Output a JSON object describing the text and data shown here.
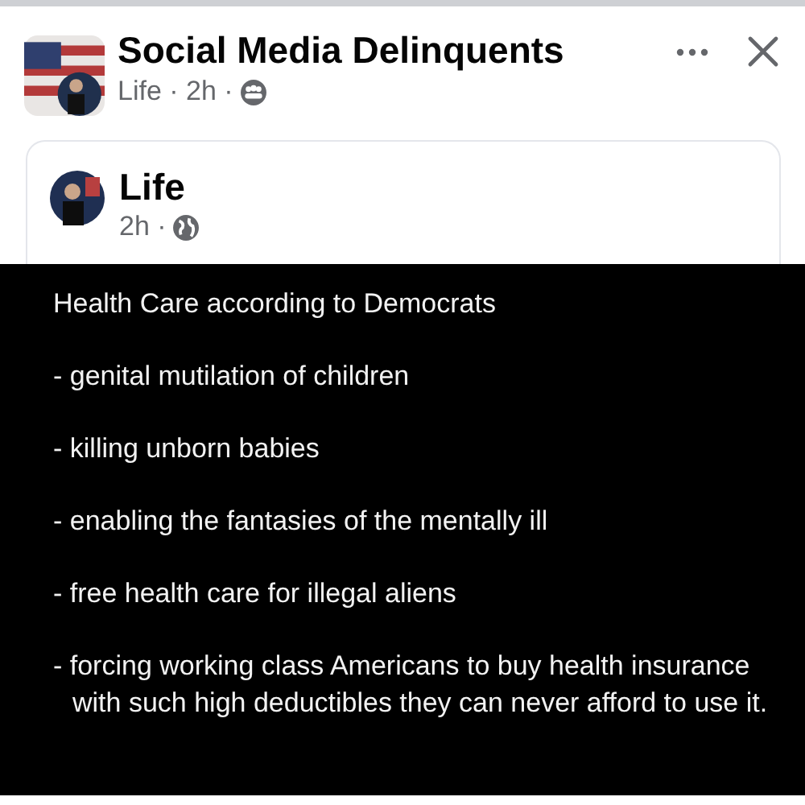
{
  "header": {
    "group_name": "Social Media Delinquents",
    "meta": "Life · 2h ·"
  },
  "shared_post": {
    "author": "Life",
    "meta": "2h ·"
  },
  "post_image": {
    "lines": [
      "Health Care according to Democrats",
      "- genital mutilation of children",
      "- killing unborn babies",
      "- enabling the fantasies of the mentally ill",
      "- free health care for illegal aliens",
      "- forcing working class Americans to buy health insurance with such high deductibles they can never afford to use it."
    ]
  }
}
